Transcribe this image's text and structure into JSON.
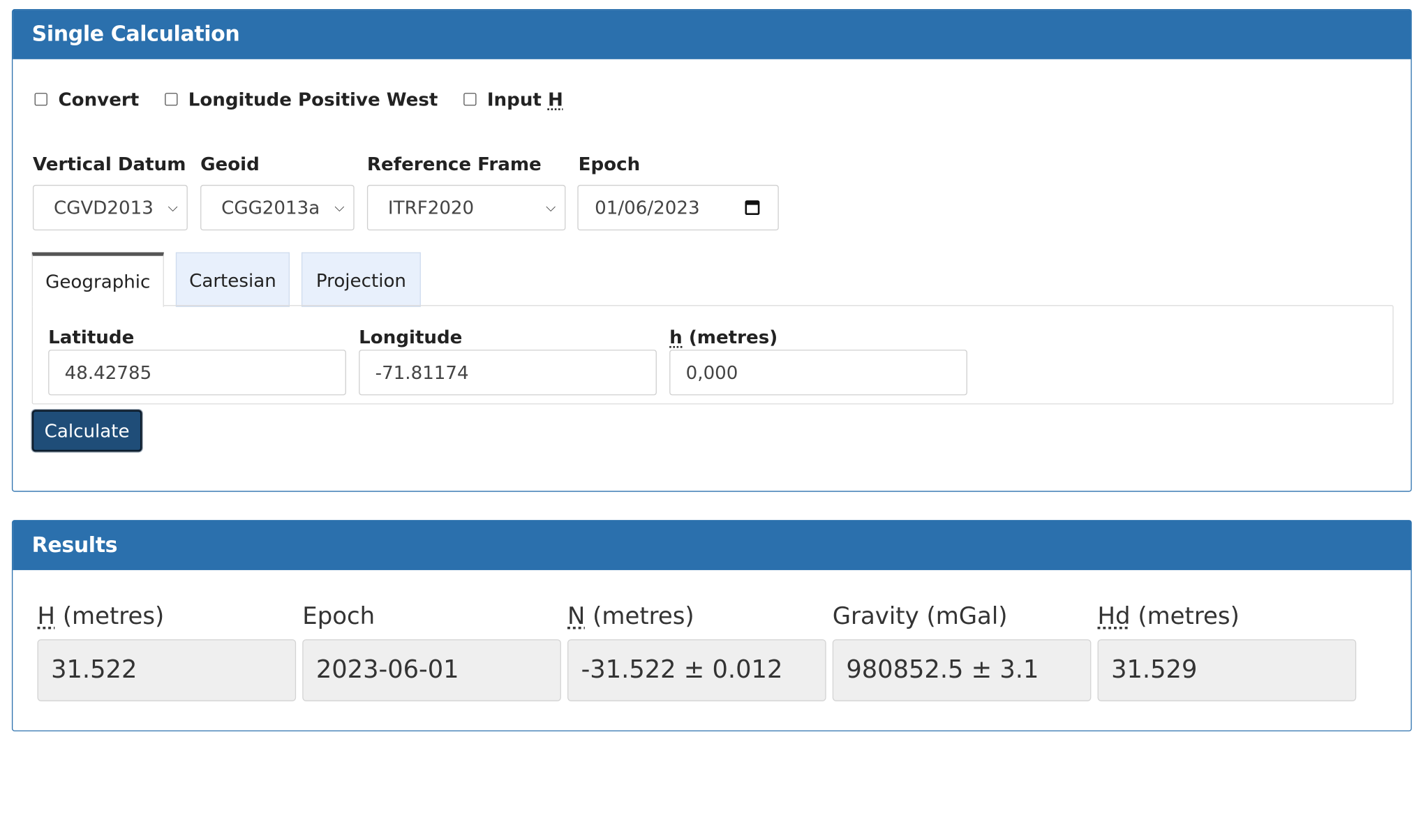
{
  "single_calculation": {
    "title": "Single Calculation",
    "options": {
      "convert": {
        "label": "Convert",
        "checked": false
      },
      "longitude_positive_west": {
        "label": "Longitude Positive West",
        "checked": false
      },
      "input_h": {
        "label_prefix": "Input ",
        "label_abbr": "H",
        "checked": false
      }
    },
    "vertical_datum": {
      "label": "Vertical Datum",
      "value": "CGVD2013"
    },
    "geoid": {
      "label": "Geoid",
      "value": "CGG2013a"
    },
    "reference_frame": {
      "label": "Reference Frame",
      "value": "ITRF2020"
    },
    "epoch": {
      "label": "Epoch",
      "value": "01/06/2023"
    },
    "tabs": [
      {
        "label": "Geographic",
        "active": true
      },
      {
        "label": "Cartesian",
        "active": false
      },
      {
        "label": "Projection",
        "active": false
      }
    ],
    "latitude": {
      "label": "Latitude",
      "value": "48.42785"
    },
    "longitude": {
      "label": "Longitude",
      "value": "-71.81174"
    },
    "h": {
      "label_abbr": "h",
      "label_suffix": " (metres)",
      "value": "0,000"
    },
    "calculate_label": "Calculate"
  },
  "results": {
    "title": "Results",
    "H": {
      "label_abbr": "H",
      "label_suffix": " (metres)",
      "value": "31.522"
    },
    "epoch": {
      "label": "Epoch",
      "value": "2023-06-01"
    },
    "N": {
      "label_abbr": "N",
      "label_suffix": " (metres)",
      "value": "-31.522 ± 0.012"
    },
    "gravity": {
      "label": "Gravity (mGal)",
      "value": "980852.5 ± 3.1"
    },
    "Hd": {
      "label_abbr": "Hd",
      "label_suffix": " (metres)",
      "value": "31.529"
    }
  }
}
